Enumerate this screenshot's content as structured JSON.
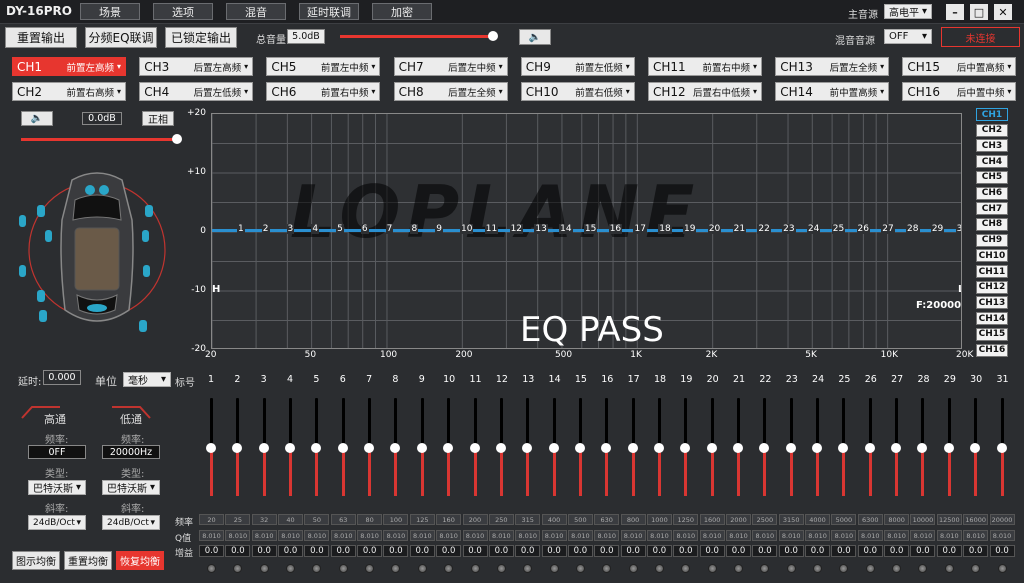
{
  "app_title": "DY-16PRO",
  "menu": [
    "场景",
    "选项",
    "混音",
    "延时联调",
    "加密"
  ],
  "main_source": {
    "label": "主音源",
    "value": "高电平"
  },
  "mix_source": {
    "label": "混音音源",
    "value": "OFF"
  },
  "connect_btn": "未连接",
  "toolbar": {
    "reset_output": "重置输出",
    "split_eq_link": "分频EQ联调",
    "locked_output": "已锁定输出",
    "master_vol_label": "总音量",
    "master_vol_value": "5.0dB",
    "master_vol_level": 0.98
  },
  "channels": [
    {
      "n": "CH1",
      "t": "前置左高频"
    },
    {
      "n": "CH3",
      "t": "后置左高频"
    },
    {
      "n": "CH5",
      "t": "前置左中频"
    },
    {
      "n": "CH7",
      "t": "后置左中频"
    },
    {
      "n": "CH9",
      "t": "前置左低频"
    },
    {
      "n": "CH11",
      "t": "前置右中频"
    },
    {
      "n": "CH13",
      "t": "后置左全频"
    },
    {
      "n": "CH15",
      "t": "后中置高频"
    },
    {
      "n": "CH2",
      "t": "前置右高频"
    },
    {
      "n": "CH4",
      "t": "后置左低频"
    },
    {
      "n": "CH6",
      "t": "前置右中频"
    },
    {
      "n": "CH8",
      "t": "后置左全频"
    },
    {
      "n": "CH10",
      "t": "前置右低频"
    },
    {
      "n": "CH12",
      "t": "后置右中低频"
    },
    {
      "n": "CH14",
      "t": "前中置高频"
    },
    {
      "n": "CH16",
      "t": "后中置中频"
    }
  ],
  "ch_volume": {
    "value": "0.0dB",
    "phase": "正相",
    "level": 1.0
  },
  "graph": {
    "y_ticks": [
      "+20",
      "+10",
      "0",
      "-10",
      "-20"
    ],
    "x_ticks": [
      "20",
      "50",
      "100",
      "200",
      "500",
      "1K",
      "2K",
      "5K",
      "10K",
      "20K"
    ],
    "h_label": "H",
    "l_label": "L",
    "f_label": "F:20000",
    "status_text": "EQ PASS",
    "logo_text": "LOPLANE"
  },
  "ch_list": [
    "CH1",
    "CH2",
    "CH3",
    "CH4",
    "CH5",
    "CH6",
    "CH7",
    "CH8",
    "CH9",
    "CH10",
    "CH11",
    "CH12",
    "CH13",
    "CH14",
    "CH15",
    "CH16"
  ],
  "delay": {
    "label": "延时:",
    "value": "0.000",
    "unit_label": "单位",
    "unit_value": "毫秒",
    "mark_label": "标号"
  },
  "highpass": {
    "title": "高通",
    "freq_label": "频率:",
    "freq": "0FF",
    "type_label": "类型:",
    "type": "巴特沃斯",
    "slope_label": "斜率:",
    "slope": "24dB/Oct"
  },
  "lowpass": {
    "title": "低通",
    "freq_label": "频率:",
    "freq": "20000Hz",
    "type_label": "类型:",
    "type": "巴特沃斯",
    "slope_label": "斜率:",
    "slope": "24dB/Oct"
  },
  "eq_buttons": {
    "graphic": "图示均衡",
    "reset": "重置均衡",
    "restore": "恢复均衡"
  },
  "bands": {
    "labels": [
      "1",
      "2",
      "3",
      "4",
      "5",
      "6",
      "7",
      "8",
      "9",
      "10",
      "11",
      "12",
      "13",
      "14",
      "15",
      "16",
      "17",
      "18",
      "19",
      "20",
      "21",
      "22",
      "23",
      "24",
      "25",
      "26",
      "27",
      "28",
      "29",
      "30",
      "31"
    ],
    "freqs": [
      "20",
      "25",
      "32",
      "40",
      "50",
      "63",
      "80",
      "100",
      "125",
      "160",
      "200",
      "250",
      "315",
      "400",
      "500",
      "630",
      "800",
      "1000",
      "1250",
      "1600",
      "2000",
      "2500",
      "3150",
      "4000",
      "5000",
      "6300",
      "8000",
      "10000",
      "12500",
      "16000",
      "20000"
    ],
    "q": "8.010",
    "gain": "0.0",
    "row_labels": {
      "freq": "频率",
      "q": "Q值",
      "gain": "增益"
    }
  }
}
